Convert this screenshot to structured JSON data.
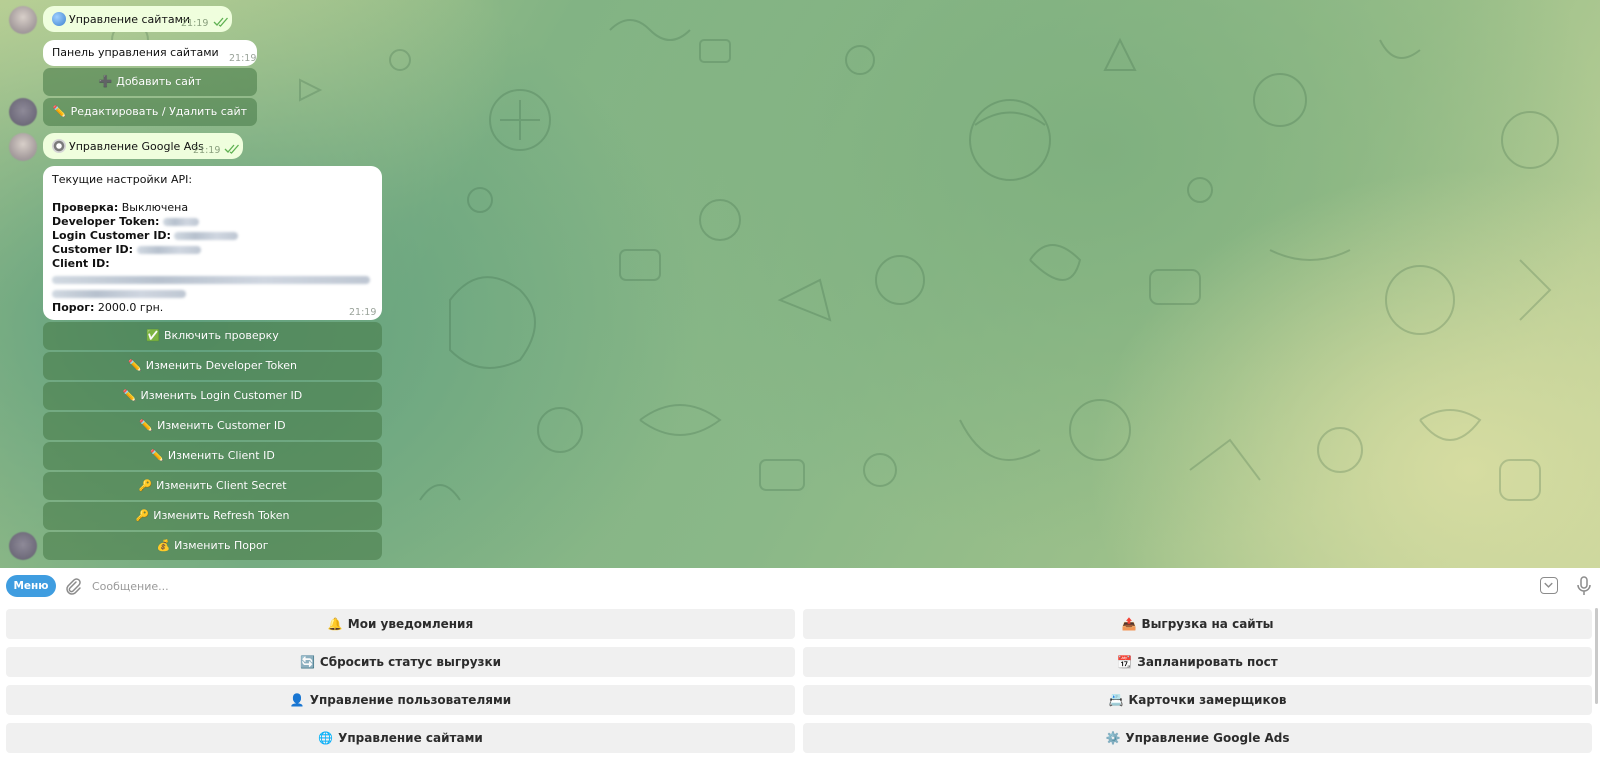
{
  "chat": {
    "messages": [
      {
        "type": "out",
        "icon": "globe-icon",
        "text": "Управление сайтами",
        "time": "21:19"
      },
      {
        "type": "in",
        "text": "Панель управления сайтами",
        "time": "21:19",
        "buttons": [
          {
            "emoji": "➕",
            "label": "Добавить сайт"
          },
          {
            "emoji": "✏️",
            "label": "Редактировать / Удалить сайт"
          }
        ]
      },
      {
        "type": "out",
        "icon": "gear-icon",
        "text": "Управление Google Ads",
        "time": "21:19"
      },
      {
        "type": "in",
        "time": "21:19",
        "heading": "Текущие настройки API:",
        "fields": {
          "check_label": "Проверка:",
          "check_value": "Выключена",
          "dev_token_label": "Developer Token:",
          "login_customer_label": "Login Customer ID:",
          "customer_label": "Customer ID:",
          "client_label": "Client ID:",
          "threshold_label": "Порог:",
          "threshold_value": "2000.0 грн."
        },
        "buttons": [
          {
            "emoji": "✅",
            "label": "Включить проверку"
          },
          {
            "emoji": "✏️",
            "label": "Изменить Developer Token"
          },
          {
            "emoji": "✏️",
            "label": "Изменить Login Customer ID"
          },
          {
            "emoji": "✏️",
            "label": "Изменить Customer ID"
          },
          {
            "emoji": "✏️",
            "label": "Изменить Client ID"
          },
          {
            "emoji": "🔑",
            "label": "Изменить Client Secret"
          },
          {
            "emoji": "🔑",
            "label": "Изменить Refresh Token"
          },
          {
            "emoji": "💰",
            "label": "Изменить Порог"
          }
        ]
      }
    ]
  },
  "input": {
    "menu_label": "Меню",
    "placeholder": "Сообщение..."
  },
  "keyboard": {
    "buttons": [
      {
        "emoji": "🔔",
        "label": "Мои уведомления"
      },
      {
        "emoji": "📤",
        "label": "Выгрузка на сайты"
      },
      {
        "emoji": "🔄",
        "label": "Сбросить статус выгрузки"
      },
      {
        "emoji": "📆",
        "label": "Запланировать пост"
      },
      {
        "emoji": "👤",
        "label": "Управление пользователями"
      },
      {
        "emoji": "📇",
        "label": "Карточки замерщиков"
      },
      {
        "emoji": "🌐",
        "label": "Управление сайтами"
      },
      {
        "emoji": "⚙️",
        "label": "Управление Google Ads"
      }
    ]
  },
  "colors": {
    "accent": "#3f9de0",
    "outgoing_bubble": "#effedd",
    "inline_button": "#5a8a5a",
    "keyboard_button": "#f0f0f0"
  }
}
